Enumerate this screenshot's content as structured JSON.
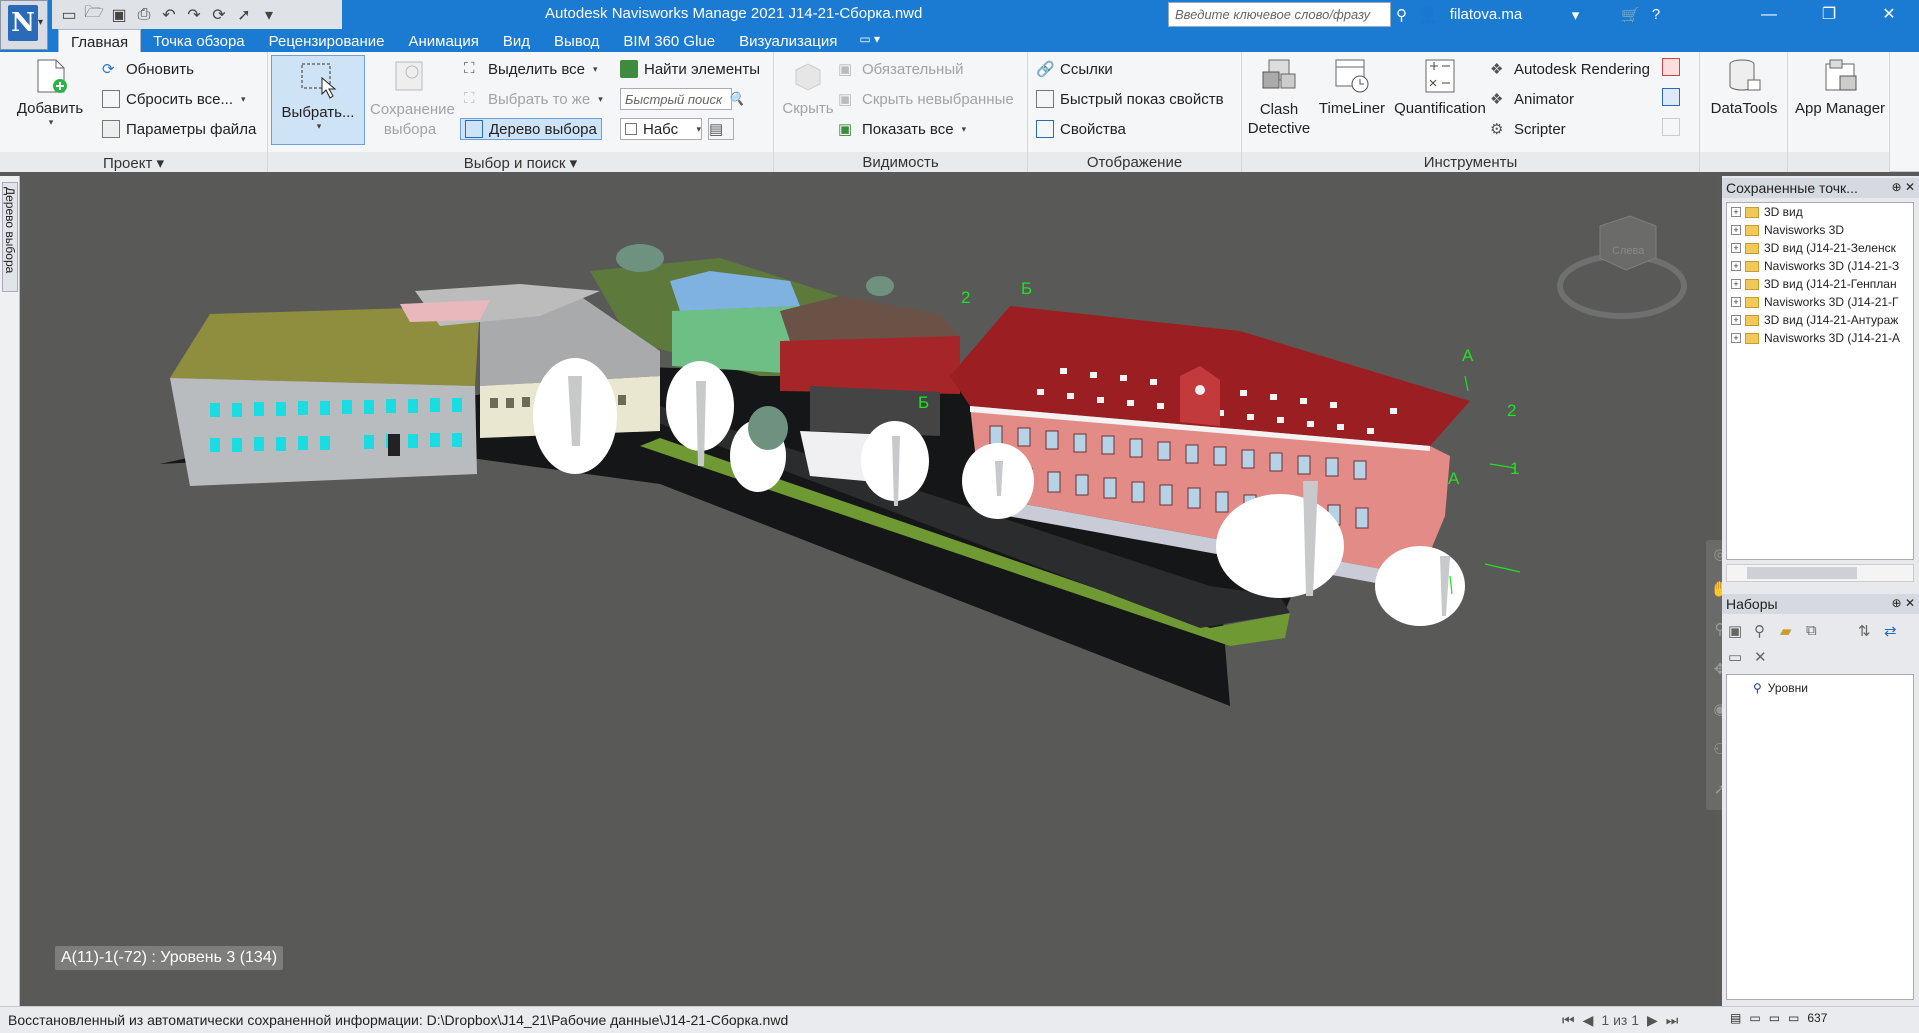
{
  "window": {
    "title": "Autodesk Navisworks Manage 2021    J14-21-Сборка.nwd",
    "search_placeholder": "Введите ключевое слово/фразу",
    "user": "filatova.ma"
  },
  "tabs": [
    "Главная",
    "Точка обзора",
    "Рецензирование",
    "Анимация",
    "Вид",
    "Вывод",
    "BIM 360 Glue",
    "Визуализация"
  ],
  "ribbon": {
    "project": {
      "title": "Проект",
      "add": "Добавить",
      "refresh": "Обновить",
      "reset_all": "Сбросить все...",
      "file_options": "Параметры файла"
    },
    "select_search": {
      "title": "Выбор и поиск",
      "select": "Выбрать...",
      "save_selection": "Сохранение выбора",
      "select_all": "Выделить все",
      "select_same": "Выбрать то же",
      "selection_tree": "Дерево выбора",
      "find_items": "Найти элементы",
      "quick_find_placeholder": "Быстрый поиск",
      "sets_value": "Набс"
    },
    "visibility": {
      "title": "Видимость",
      "hide": "Скрыть",
      "required": "Обязательный",
      "hide_unselected": "Скрыть невыбранные",
      "unhide_all": "Показать все"
    },
    "display": {
      "title": "Отображение",
      "links": "Ссылки",
      "quick_props": "Быстрый  показ свойств",
      "properties": "Свойства"
    },
    "tools": {
      "title": "Инструменты",
      "clash_detective": "Clash\nDetective",
      "clash_line1": "Clash",
      "clash_line2": "Detective",
      "timeliner": "TimeLiner",
      "quantification": "Quantification",
      "autodesk_rendering": "Autodesk Rendering",
      "animator": "Animator",
      "scripter": "Scripter",
      "datatools": "DataTools",
      "app_manager": "App Manager"
    }
  },
  "left_strip_label": "Дерево выбора",
  "viewport": {
    "tooltip": "А(11)-1(-72) : Уровень 3 (134)",
    "grid_labels": [
      "2",
      "Б",
      "Б",
      "А",
      "2",
      "1",
      "А"
    ],
    "viewcube_label": "Слева"
  },
  "saved_viewpoints": {
    "title": "Сохраненные точк...",
    "items": [
      "3D вид",
      "Navisworks 3D",
      "3D вид (J14-21-Зеленск",
      "Navisworks 3D (J14-21-З",
      "3D вид (J14-21-Генплан",
      "Navisworks 3D (J14-21-Г",
      "3D вид (J14-21-Антураж",
      "Navisworks 3D (J14-21-А"
    ]
  },
  "sets": {
    "title": "Наборы",
    "items": [
      "Уровни"
    ]
  },
  "status": {
    "text": "Восстановленный из автоматически сохраненной информации: D:\\Dropbox\\J14_21\\Рабочие данные\\J14-21-Сборка.nwd",
    "page": "1 из 1",
    "memory": "637"
  },
  "colors": {
    "titlebar": "#1b7ad2",
    "viewport_bg": "#595a57",
    "roof_red": "#9b1f22",
    "facade_pink": "#e38b86",
    "grid_green": "#22e022"
  }
}
